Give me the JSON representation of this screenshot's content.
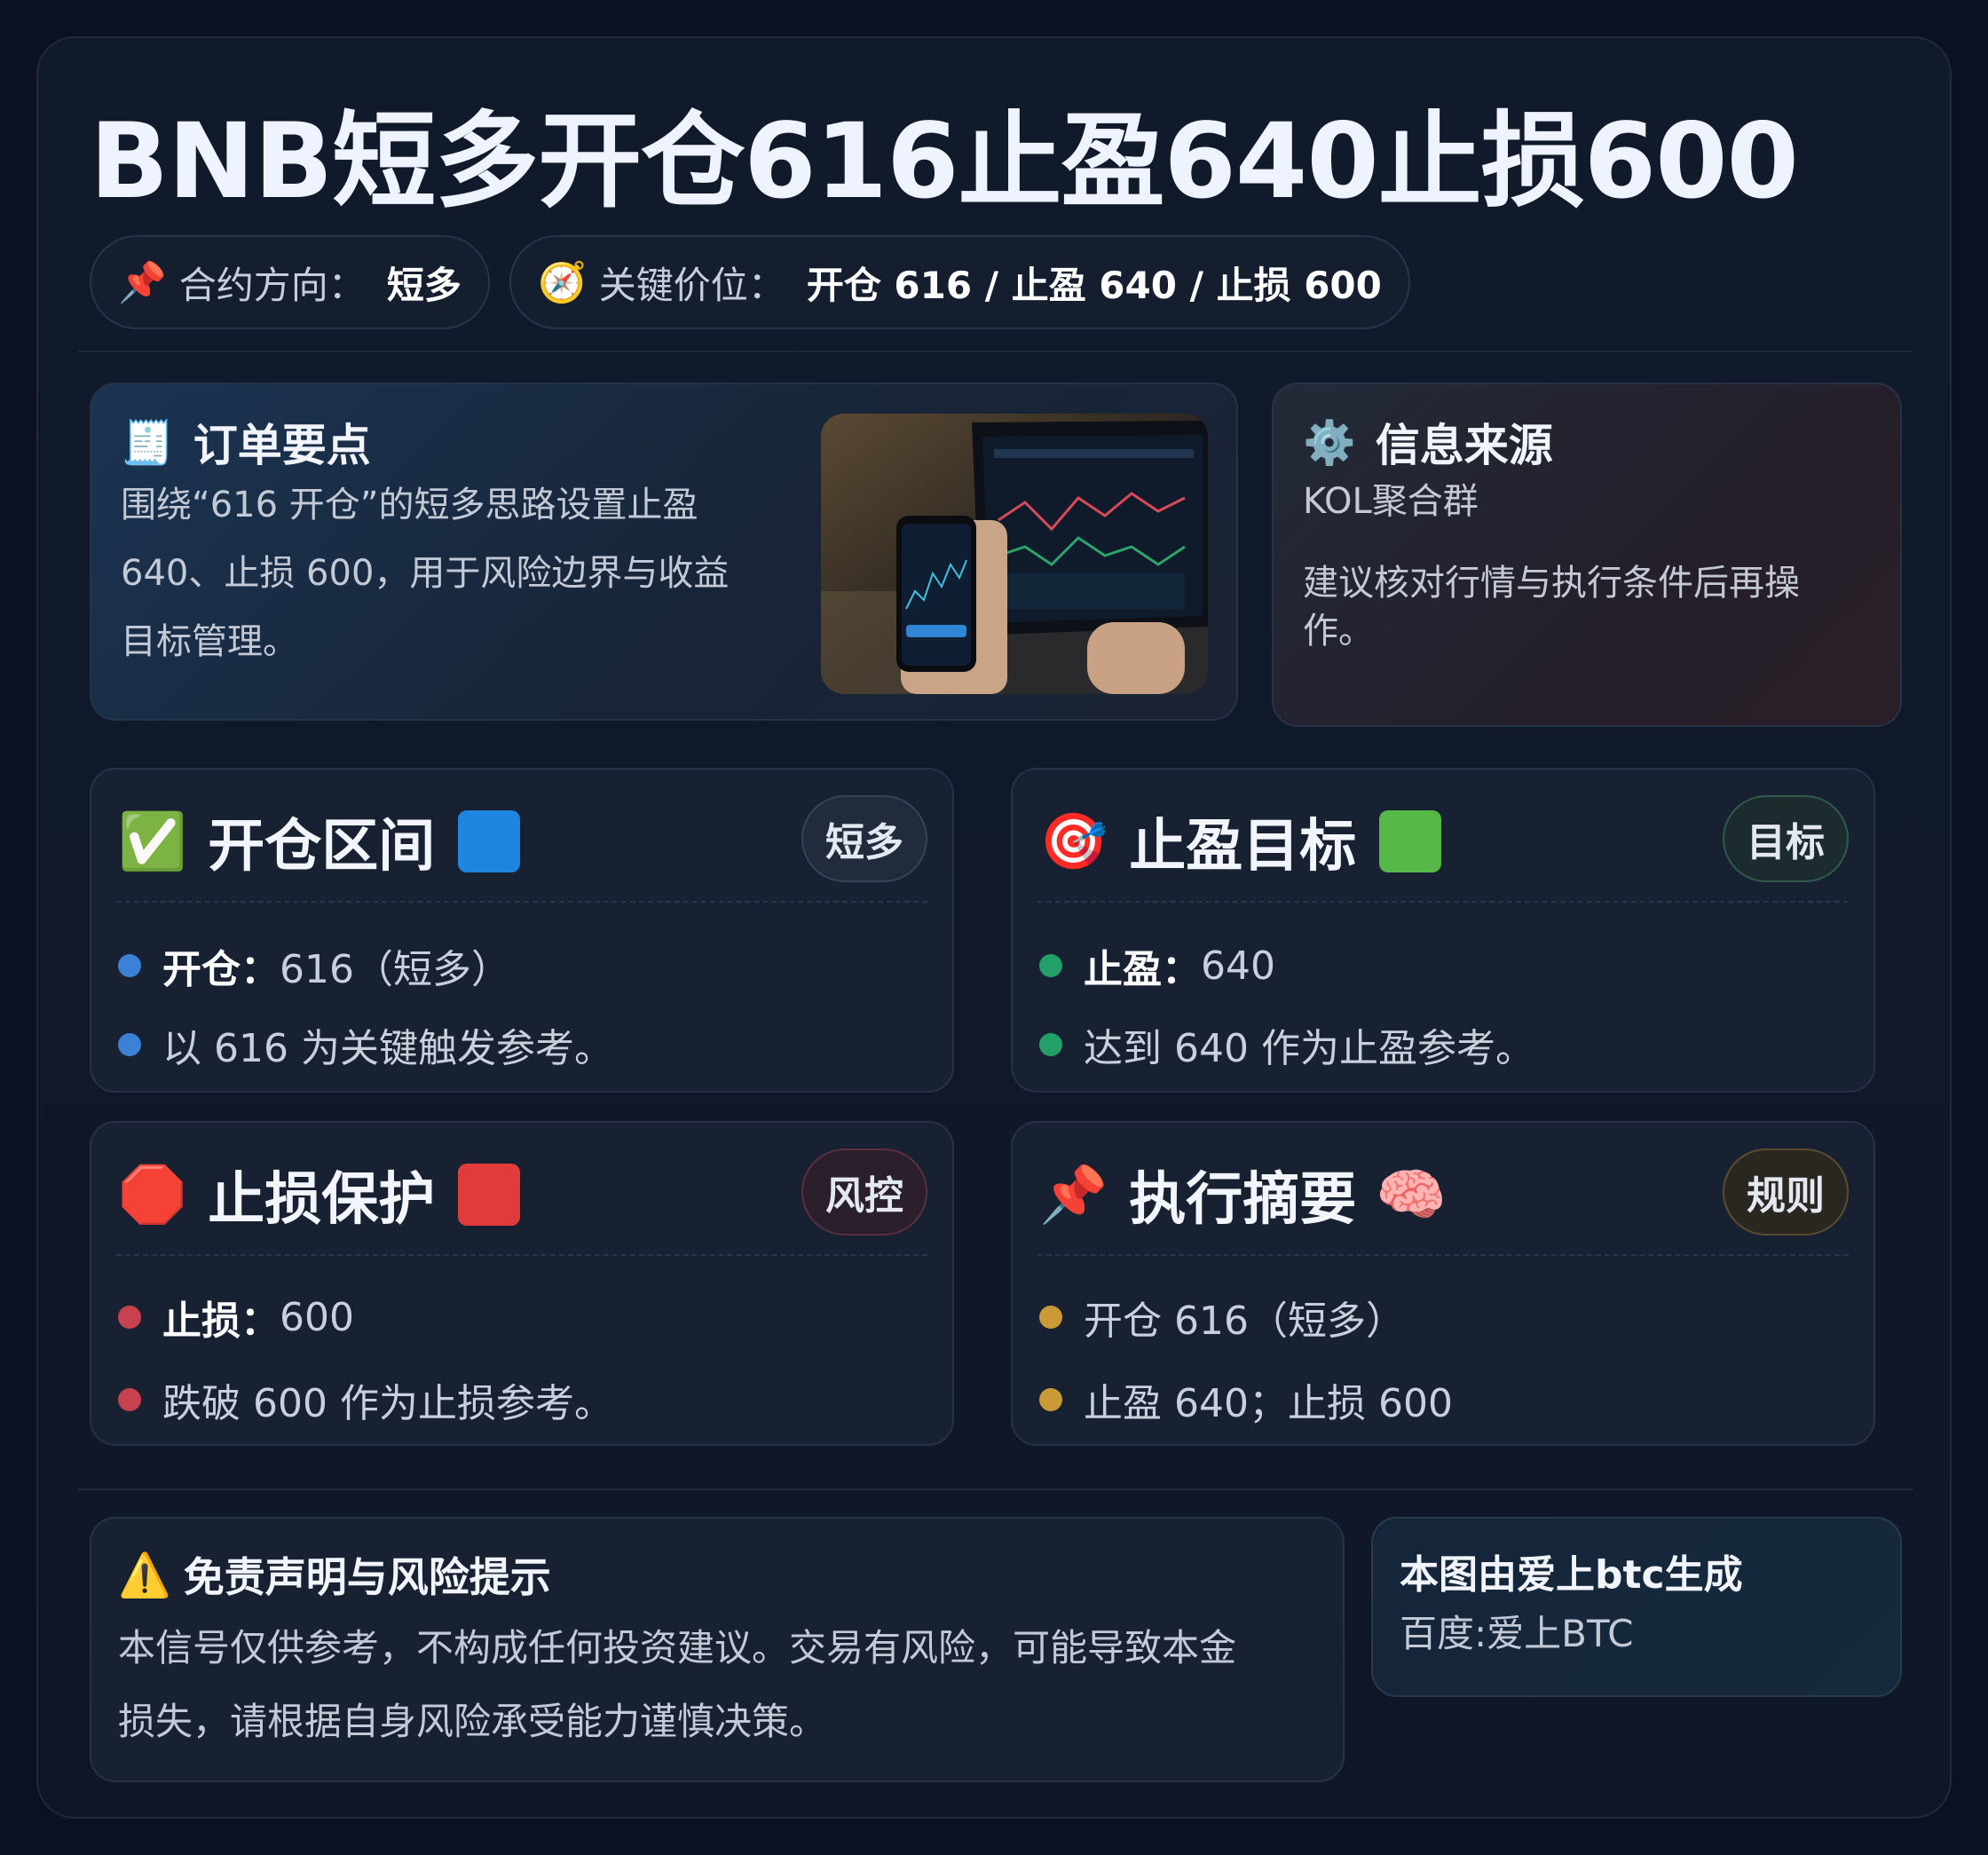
{
  "title": "BNB短多开仓616止盈640止损600",
  "pills": [
    {
      "icon": "📌",
      "key": "合约方向：",
      "value": "短多"
    },
    {
      "icon": "🧭",
      "key": "关键价位：",
      "value": "开仓 616 / 止盈 640 / 止损 600"
    }
  ],
  "order": {
    "icon": "🧾",
    "title": "订单要点",
    "lines": [
      "围绕“616 开仓”的短多思路设置止盈",
      "640、止损 600，用于风险边界与收益",
      "目标管理。"
    ]
  },
  "source": {
    "icon": "⚙️",
    "title": "信息来源",
    "name": "KOL聚合群",
    "lines": [
      "建议核对行情与执行条件后再操",
      "作。"
    ]
  },
  "cards": {
    "entry": {
      "icon": "✅",
      "title": "开仓区间",
      "badge": "短多",
      "b1_label": "开仓：",
      "b1_value": "616（短多）",
      "b2": "以 616 为关键触发参考。"
    },
    "tp": {
      "icon": "🎯",
      "title": "止盈目标",
      "badge": "目标",
      "b1_label": "止盈：",
      "b1_value": "640",
      "b2": "达到 640 作为止盈参考。"
    },
    "sl": {
      "icon": "🛑",
      "title": "止损保护",
      "badge": "风控",
      "b1_label": "止损：",
      "b1_value": "600",
      "b2": "跌破 600 作为止损参考。"
    },
    "summary": {
      "icon": "📌",
      "title": "执行摘要",
      "tail_icon": "🧠",
      "badge": "规则",
      "b1": "开仓 616（短多）",
      "b2": "止盈 640；止损 600"
    }
  },
  "disclaimer": {
    "icon": "⚠️",
    "title": "免责声明与风险提示",
    "lines": [
      "本信号仅供参考，不构成任何投资建议。交易有风险，可能导致本金",
      "损失，请根据自身风险承受能力谨慎决策。"
    ]
  },
  "credit": {
    "title": "本图由爱上btc生成",
    "sub": "百度:爱上BTC"
  },
  "colors": {
    "blue": "#3b82d6",
    "green": "#23a06a",
    "red": "#c8414f",
    "gold": "#c99a35",
    "sq_blue": "#1f86e0",
    "sq_green": "#56b947",
    "sq_red": "#e23b3b"
  }
}
